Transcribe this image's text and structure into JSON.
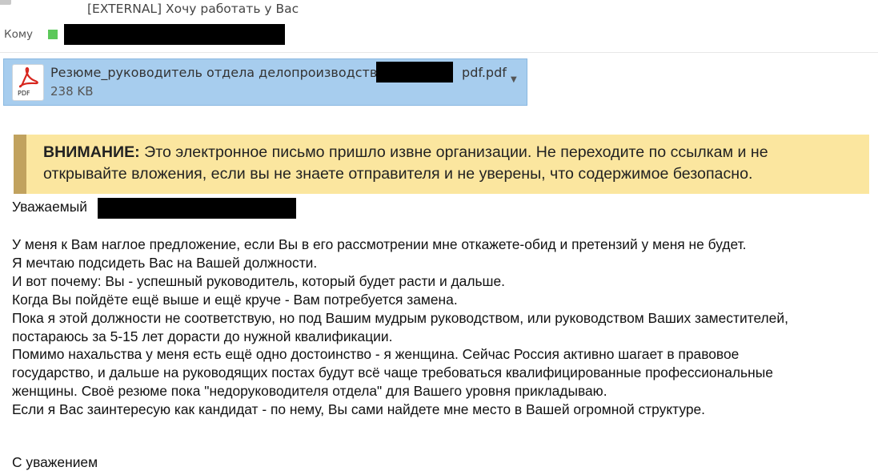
{
  "email": {
    "subject": "[EXTERNAL] Хочу работать у Вас",
    "to_label": "Кому"
  },
  "attachment": {
    "icon": "pdf-file-icon",
    "icon_tag": "PDF",
    "name_prefix": "Резюме_руководитель отдела делопроизводства",
    "name_suffix": "pdf.pdf",
    "size": "238 KB"
  },
  "banner": {
    "prefix": "ВНИМАНИЕ:",
    "line1": " Это электронное письмо пришло извне организации. Не переходите по ссылкам и не",
    "line2": "открывайте вложения, если вы не знаете отправителя и не уверены, что содержимое безопасно."
  },
  "colors": {
    "banner_bg": "#fbe69f",
    "banner_bar": "#c1a25e",
    "attachment_bg": "#a7cdee",
    "presence": "#5cc85a"
  },
  "body": {
    "greeting": "Уважаемый",
    "lines": [
      "У меня к Вам наглое предложение, если Вы в его рассмотрении мне откажете-обид и претензий у меня не будет.",
      "Я мечтаю подсидеть Вас на Вашей должности.",
      "И вот почему: Вы - успешный руководитель, который будет расти и дальше.",
      "Когда Вы пойдёте ещё выше и ещё круче - Вам потребуется замена.",
      "Пока я этой должности не соответствую, но под Вашим мудрым руководством, или руководством Ваших заместителей,",
      "постараюсь за 5-15 лет дорасти до нужной квалификации.",
      "Помимо нахальства у меня есть ещё одно достоинство - я женщина. Сейчас Россия активно шагает в правовое",
      "государство, и дальше на руководящих постах будут всё чаще требоваться квалифицированные профессиональные",
      "женщины. Своё резюме пока \"недоруководителя отдела\" для Вашего уровня прикладываю.",
      "Если я Вас заинтересую как кандидат - по нему, Вы сами найдете мне место в Вашей огромной структуре."
    ],
    "closing": "С уважением"
  }
}
